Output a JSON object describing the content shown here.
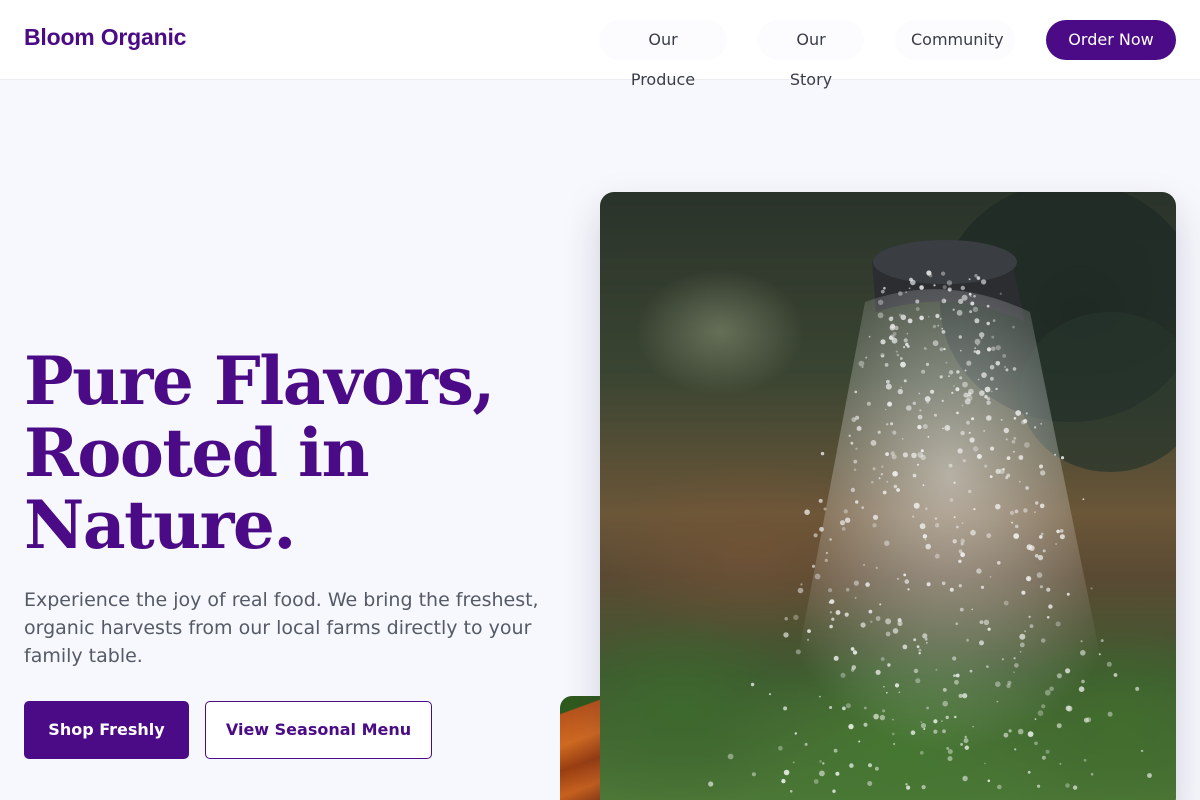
{
  "header": {
    "logo": "Bloom Organic",
    "nav": [
      "Our Produce",
      "Our Story",
      "Community"
    ],
    "cta": "Order Now"
  },
  "hero": {
    "title_lines": [
      "Pure Flavors,",
      "Rooted in",
      "Nature."
    ],
    "subtitle": "Experience the joy of real food. We bring the freshest, organic harvests from our local farms directly to your family table.",
    "primary_button": "Shop Freshly",
    "secondary_button": "View Seasonal Menu"
  },
  "images": {
    "main": "watering-can-garden-photo",
    "thumb": "carrots-photo"
  },
  "colors": {
    "brand": "#4b0b86",
    "background": "#f7f8fd",
    "text": "#545a66"
  }
}
